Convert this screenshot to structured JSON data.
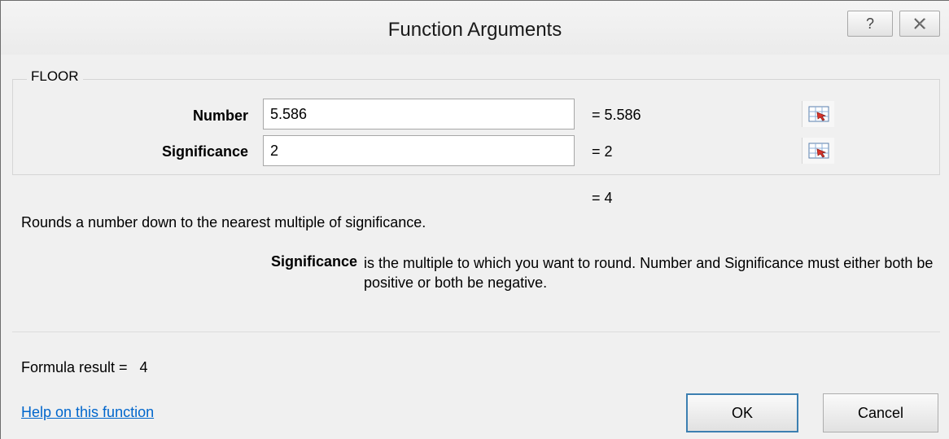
{
  "window": {
    "title": "Function Arguments",
    "help_glyph": "?",
    "close_icon": "close-icon"
  },
  "function": {
    "name": "FLOOR",
    "arguments": [
      {
        "label": "Number",
        "value": "5.586",
        "evaluated": "=  5.586"
      },
      {
        "label": "Significance",
        "value": "2",
        "evaluated": "=  2"
      }
    ],
    "result_line": "=  4",
    "description": "Rounds a number down to the nearest multiple of significance.",
    "arg_help_name": "Significance",
    "arg_help_text": "is the multiple to which you want to round. Number and Significance must either both be positive or both be negative."
  },
  "footer": {
    "formula_result": "Formula result =   4",
    "help_link": "Help on this function",
    "ok_label": "OK",
    "cancel_label": "Cancel"
  },
  "colors": {
    "link": "#0066cc",
    "default_button_border": "#3c7fb1"
  }
}
